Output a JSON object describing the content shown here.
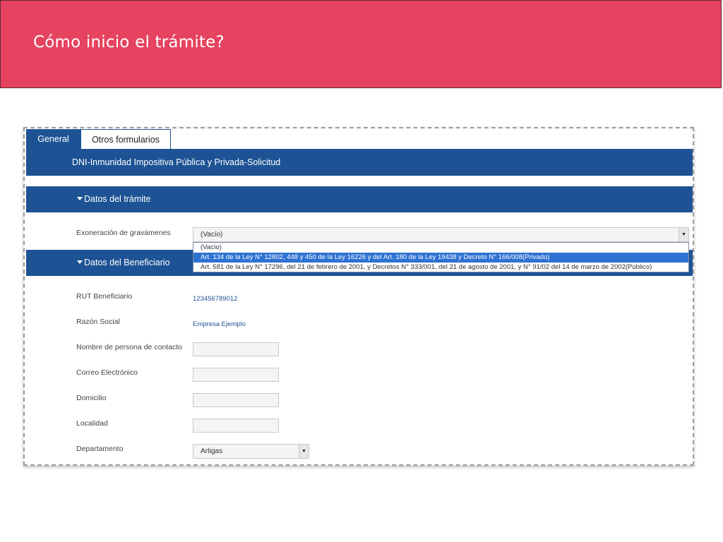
{
  "slide": {
    "title": "Cómo inicio el trámite?"
  },
  "tabs": [
    "General",
    "Otros formularios"
  ],
  "form": {
    "title": "DNI-Inmunidad Impositiva Pública y Privada-Solicitud",
    "section1": "Datos del trámite",
    "section2": "Datos del Beneficiario",
    "exoneracion": {
      "label": "Exoneración de gravámenes",
      "value": "(Vacío)",
      "options": [
        "(Vacío)",
        "Art. 134 de la Ley N° 12802, 448 y 450 de la Ley 16226 y del Art. 180 de la Ley 19438 y Decreto N° 166/008(Privado)",
        "Art. 581 de la Ley N° 17296, del 21 de febrero de 2001, y Decretos N° 333/001, del 21 de agosto de 2001, y N° 91/02 del 14 de marzo de 2002(Público)"
      ]
    },
    "rut": {
      "label": "RUT Beneficiario",
      "value": "123456789012"
    },
    "razon": {
      "label": "Razón Social",
      "value": "Empresa Ejemplo"
    },
    "contacto": {
      "label": "Nombre de persona de contacto",
      "value": ""
    },
    "correo": {
      "label": "Correo Electrónico",
      "value": ""
    },
    "domicilio": {
      "label": "Domicilio",
      "value": ""
    },
    "localidad": {
      "label": "Localidad",
      "value": ""
    },
    "departamento": {
      "label": "Departamento",
      "value": "Artigas"
    }
  },
  "colors": {
    "banner": "#e5435f",
    "primary": "#1d5394",
    "selected_option": "#2e72d2"
  },
  "icons": {
    "section_toggle": "triangle-down-icon",
    "select_arrow": "chevron-down-icon"
  }
}
